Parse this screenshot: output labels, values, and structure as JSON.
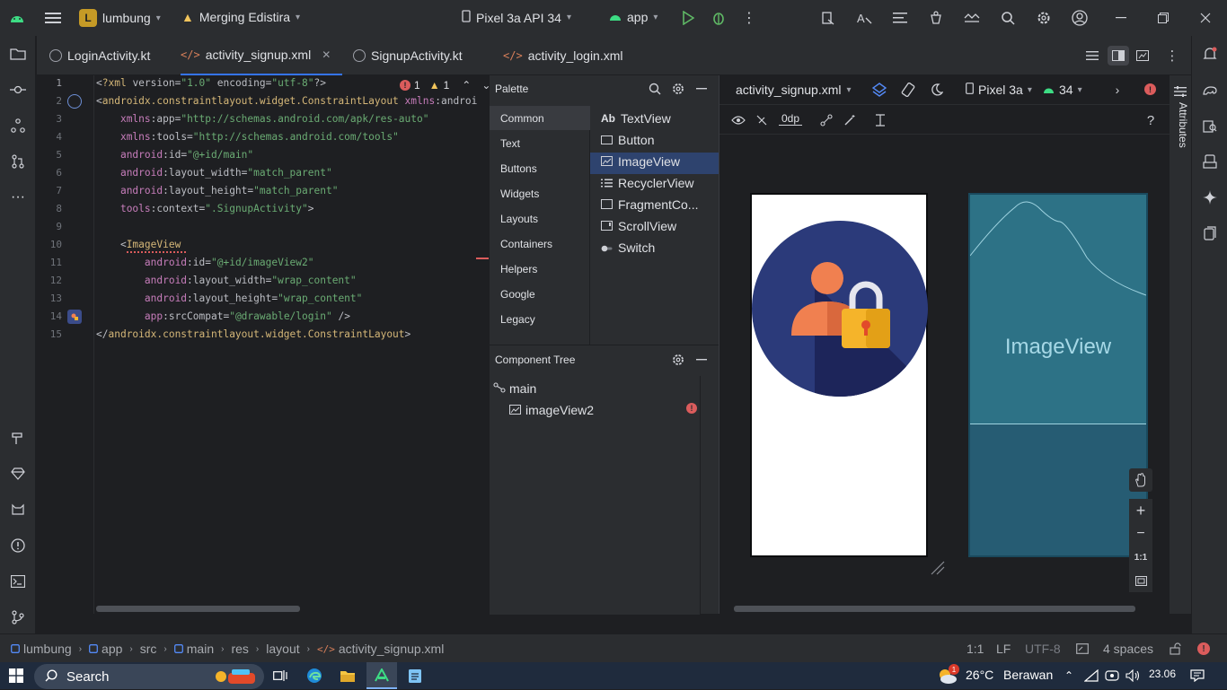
{
  "titlebar": {
    "project_badge": "L",
    "project_name": "lumbung",
    "branch_name": "Merging Edistira",
    "device_name": "Pixel 3a API 34",
    "run_config": "app"
  },
  "tabs": [
    {
      "label": "LoginActivity.kt"
    },
    {
      "label": "activity_signup.xml"
    },
    {
      "label": "SignupActivity.kt"
    },
    {
      "label": "activity_login.xml"
    }
  ],
  "editor": {
    "error_count": "1",
    "warning_count": "1",
    "line_numbers": [
      "1",
      "2",
      "3",
      "4",
      "5",
      "6",
      "7",
      "8",
      "9",
      "10",
      "11",
      "12",
      "13",
      "14",
      "15"
    ],
    "lines": [
      "<?xml version=\"1.0\" encoding=\"utf-8\"?>",
      "<androidx.constraintlayout.widget.ConstraintLayout xmlns:androi",
      "    xmlns:app=\"http://schemas.android.com/apk/res-auto\"",
      "    xmlns:tools=\"http://schemas.android.com/tools\"",
      "    android:id=\"@+id/main\"",
      "    android:layout_width=\"match_parent\"",
      "    android:layout_height=\"match_parent\"",
      "    tools:context=\".SignupActivity\">",
      "",
      "    <ImageView",
      "        android:id=\"@+id/imageView2\"",
      "        android:layout_width=\"wrap_content\"",
      "        android:layout_height=\"wrap_content\"",
      "        app:srcCompat=\"@drawable/login\" />",
      "</androidx.constraintlayout.widget.ConstraintLayout>"
    ]
  },
  "palette": {
    "title": "Palette",
    "categories": [
      "Common",
      "Text",
      "Buttons",
      "Widgets",
      "Layouts",
      "Containers",
      "Helpers",
      "Google",
      "Legacy"
    ],
    "selected_category": "Common",
    "items": [
      "TextView",
      "Button",
      "ImageView",
      "RecyclerView",
      "FragmentCo...",
      "ScrollView",
      "Switch"
    ],
    "selected_item": "ImageView",
    "textview_prefix": "Ab"
  },
  "component_tree": {
    "title": "Component Tree",
    "root": "main",
    "child": "imageView2"
  },
  "design": {
    "file_selector": "activity_signup.xml",
    "device": "Pixel 3a",
    "api_level": "34",
    "margin_value": "0dp",
    "blueprint_label": "ImageView",
    "zoom_ratio": "1:1",
    "attributes_label": "Attributes"
  },
  "statusbar": {
    "breadcrumbs": [
      "lumbung",
      "app",
      "src",
      "main",
      "res",
      "layout",
      "activity_signup.xml"
    ],
    "position": "1:1",
    "line_ending": "LF",
    "encoding": "UTF-8",
    "indent": "4 spaces"
  },
  "taskbar": {
    "search_label": "Search",
    "weather_temp": "26°C",
    "weather_desc": "Berawan",
    "clock": "23.06",
    "weather_badge": "1"
  },
  "colors": {
    "accent": "#3574f0",
    "error": "#db5c5c",
    "circle_bg": "#2b3a7a",
    "person": "#f08050",
    "lock": "#f5b42a",
    "blueprint": "#2a6a80"
  }
}
